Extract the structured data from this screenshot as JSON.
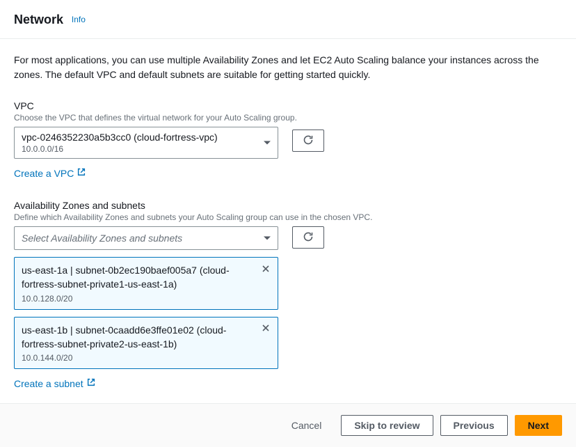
{
  "header": {
    "title": "Network",
    "info_link": "Info"
  },
  "intro": "For most applications, you can use multiple Availability Zones and let EC2 Auto Scaling balance your instances across the zones. The default VPC and default subnets are suitable for getting started quickly.",
  "vpc": {
    "label": "VPC",
    "description": "Choose the VPC that defines the virtual network for your Auto Scaling group.",
    "selected_main": "vpc-0246352230a5b3cc0 (cloud-fortress-vpc)",
    "selected_sub": "10.0.0.0/16",
    "create_link": "Create a VPC"
  },
  "az": {
    "label": "Availability Zones and subnets",
    "description": "Define which Availability Zones and subnets your Auto Scaling group can use in the chosen VPC.",
    "placeholder": "Select Availability Zones and subnets",
    "selected": [
      {
        "main": "us-east-1a | subnet-0b2ec190baef005a7 (cloud-fortress-subnet-private1-us-east-1a)",
        "sub": "10.0.128.0/20"
      },
      {
        "main": "us-east-1b | subnet-0caadd6e3ffe01e02 (cloud-fortress-subnet-private2-us-east-1b)",
        "sub": "10.0.144.0/20"
      }
    ],
    "create_link": "Create a subnet"
  },
  "footer": {
    "cancel": "Cancel",
    "skip": "Skip to review",
    "previous": "Previous",
    "next": "Next"
  }
}
